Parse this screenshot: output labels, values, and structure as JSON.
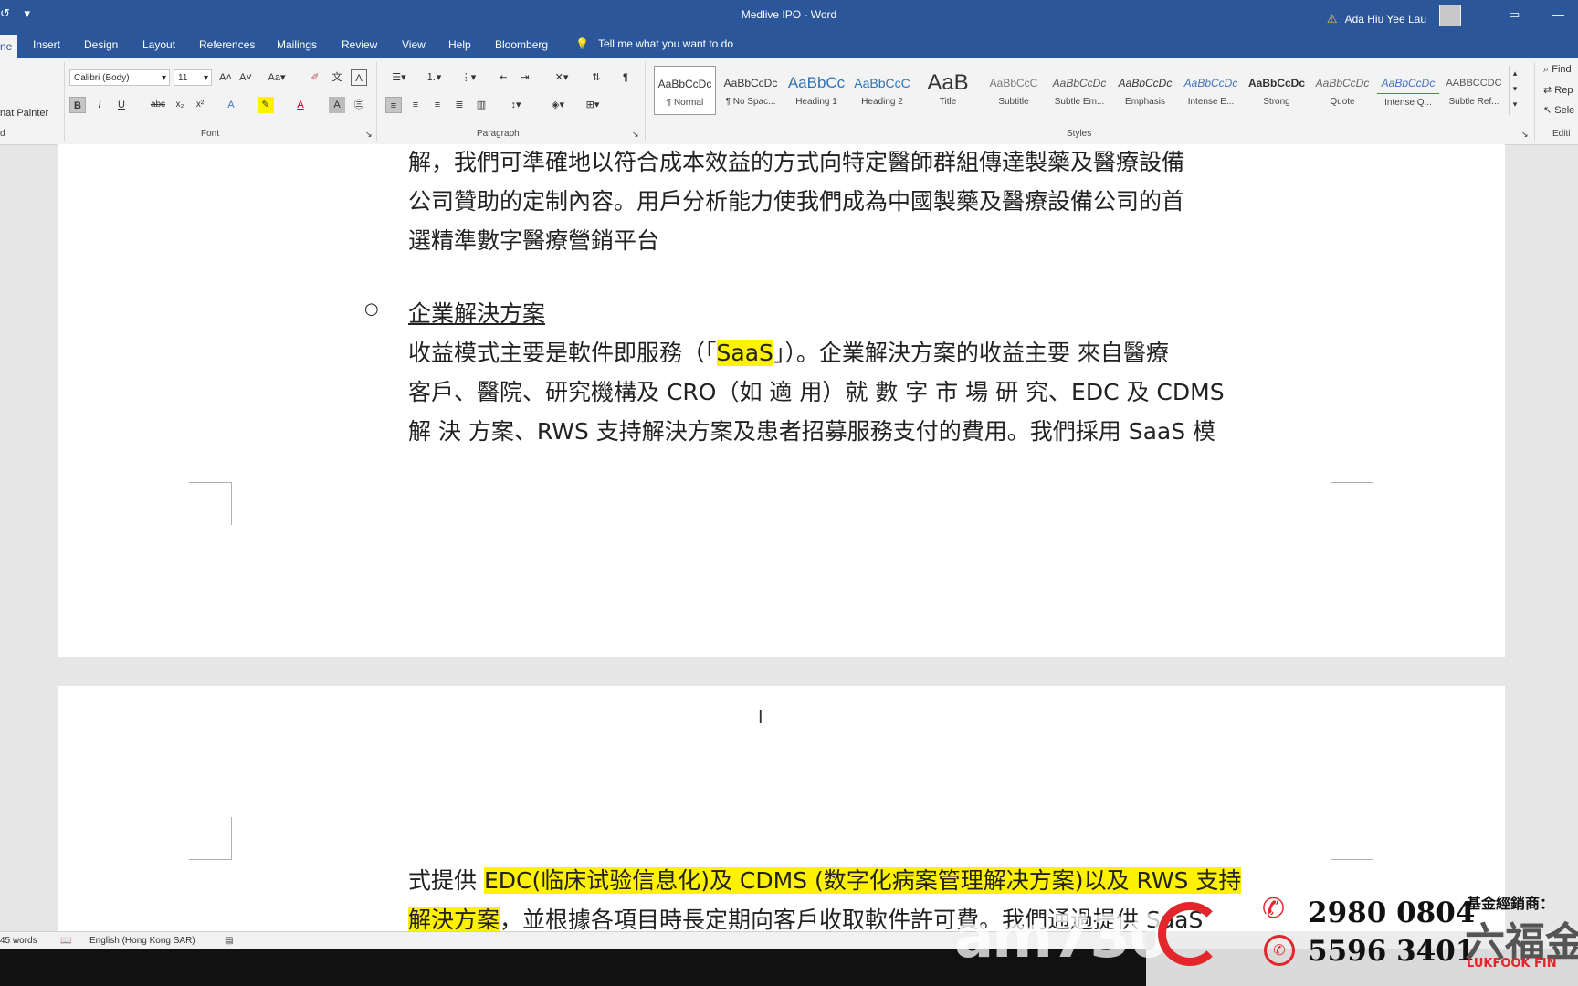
{
  "window": {
    "title": "Medlive IPO  -  Word",
    "user_name": "Ada Hiu Yee Lau"
  },
  "tabs": [
    "ne",
    "Insert",
    "Design",
    "Layout",
    "References",
    "Mailings",
    "Review",
    "View",
    "Help",
    "Bloomberg"
  ],
  "tell_me": "Tell me what you want to do",
  "ribbon": {
    "clipboard": {
      "format_painter": "nat Painter",
      "label": "d"
    },
    "font": {
      "family": "Calibri (Body)",
      "size": "11",
      "label": "Font"
    },
    "paragraph": {
      "label": "Paragraph"
    },
    "styles": {
      "label": "Styles",
      "items": [
        {
          "sample": "AaBbCcDc",
          "name": "¶ Normal"
        },
        {
          "sample": "AaBbCcDc",
          "name": "¶ No Spac..."
        },
        {
          "sample": "AaBbCc",
          "name": "Heading 1"
        },
        {
          "sample": "AaBbCcC",
          "name": "Heading 2"
        },
        {
          "sample": "AaB",
          "name": "Title"
        },
        {
          "sample": "AaBbCcC",
          "name": "Subtitle"
        },
        {
          "sample": "AaBbCcDc",
          "name": "Subtle Em..."
        },
        {
          "sample": "AaBbCcDc",
          "name": "Emphasis"
        },
        {
          "sample": "AaBbCcDc",
          "name": "Intense E..."
        },
        {
          "sample": "AaBbCcDc",
          "name": "Strong"
        },
        {
          "sample": "AaBbCcDc",
          "name": "Quote"
        },
        {
          "sample": "AaBbCcDc",
          "name": "Intense Q..."
        },
        {
          "sample": "AABBCCDC",
          "name": "Subtle Ref..."
        }
      ]
    },
    "editing": {
      "find": "Find",
      "replace": "Rep",
      "select": "Sele",
      "label": "Editi"
    }
  },
  "document": {
    "p1_line1": "解，我們可準確地以符合成本效益的方式向特定醫師群組傳達製藥及醫療設備",
    "p1_line2": "公司贊助的定制內容。用戶分析能力使我們成為中國製藥及醫療設備公司的首",
    "p1_line3": "選精準數字醫療營銷平台",
    "bullet": "○",
    "heading": "企業解決方案",
    "p2_line1_a": "收益模式主要是軟件即服務（「",
    "p2_line1_hl": "SaaS",
    "p2_line1_b": "」）。企業解決方案的收益主要 來自醫療",
    "p2_line2": "客戶、醫院、研究機構及 CRO（如 適 用）就 數 字 市 場 研 究、EDC 及 CDMS",
    "p2_line3": "解 決 方案、RWS 支持解決方案及患者招募服務支付的費用。我們採用 SaaS 模",
    "p3_line1_a": "式提供 ",
    "p3_line1_hl": "EDC(临床试验信息化)及 CDMS (数字化病案管理解决方案)以及 RWS 支持",
    "p3_line2_hl": "解決方案",
    "p3_line2_b": "，並根據各項目時長定期向客戶收取軟件許可費。我們通過提供 SaaS"
  },
  "status": {
    "words": "45 words",
    "language": "English (Hong Kong SAR)"
  },
  "overlay": {
    "am730": "am730",
    "fund_distributor": "基金經銷商：",
    "phone1": "2980 0804",
    "phone2": "5596 3401",
    "brand_cn": "六福金",
    "brand_en": "LUKFOOK FIN"
  },
  "colors": {
    "word_blue": "#2b579a",
    "highlight": "#fff200",
    "overlay_red": "#e3262b"
  }
}
